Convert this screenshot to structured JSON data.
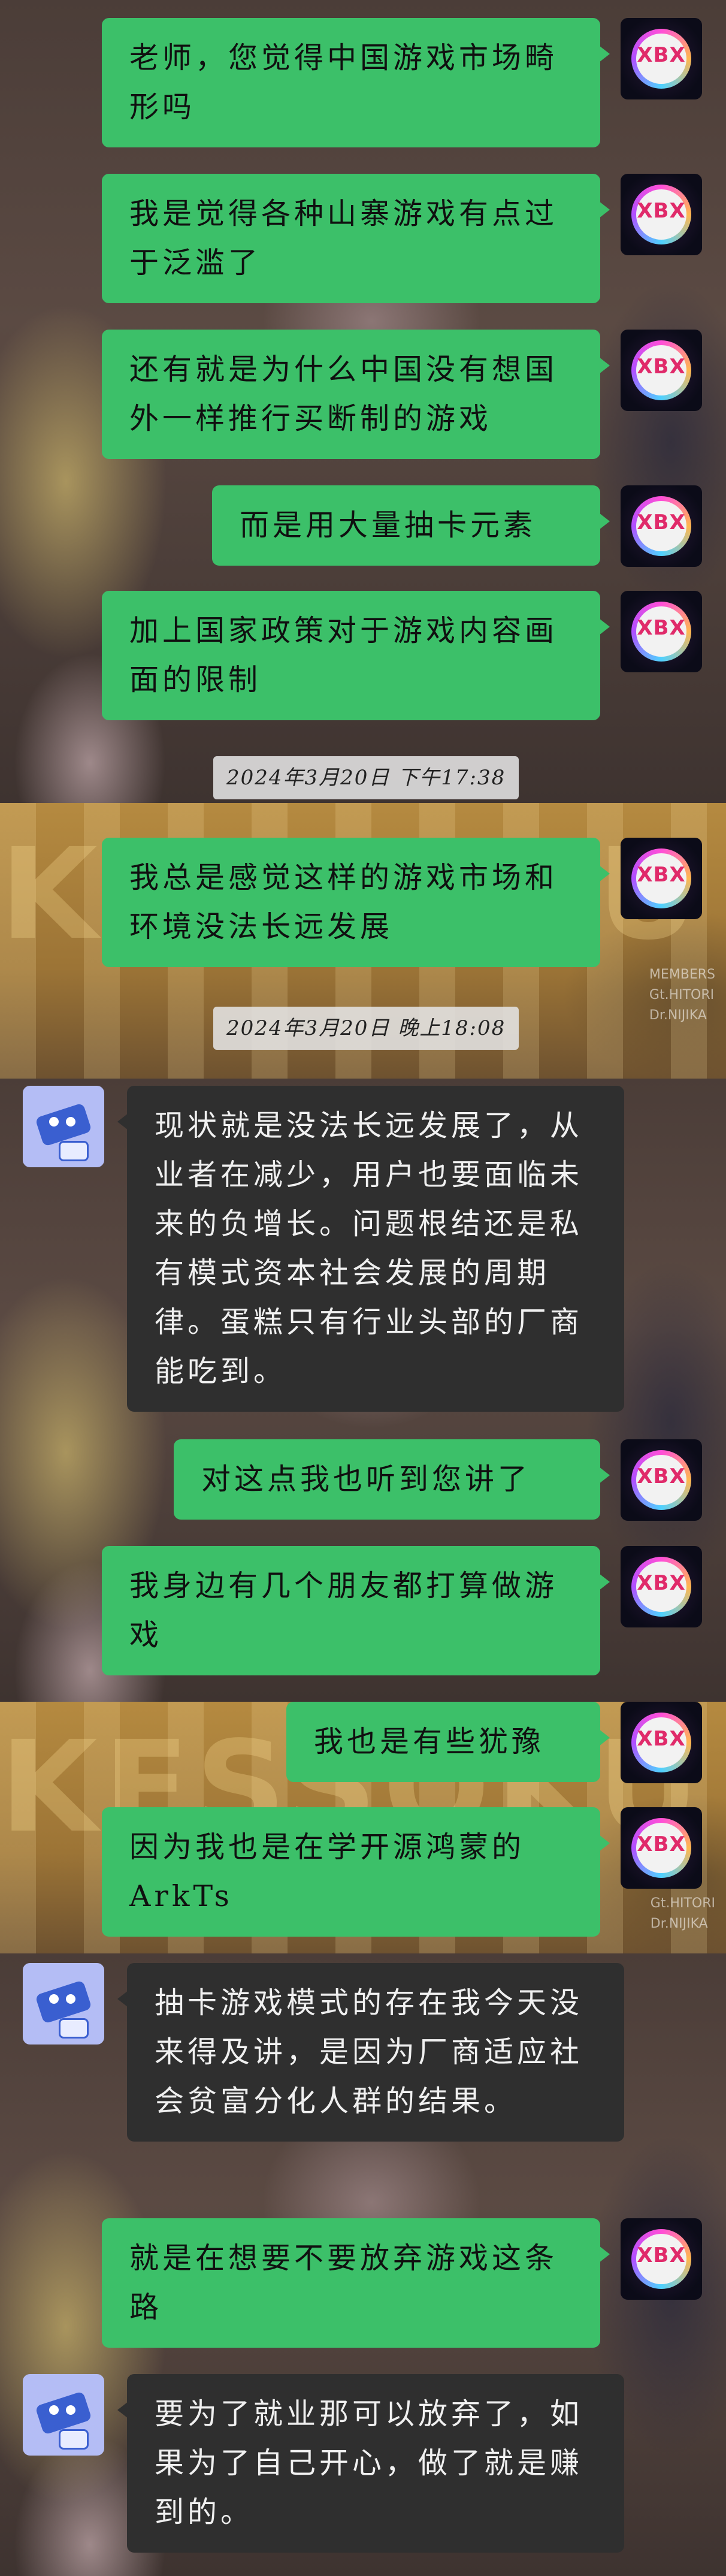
{
  "background": {
    "band_text": "KESSOKU BAND",
    "credits": [
      "MEMBERS",
      "Gt.HITORI",
      "Dr.NIJIKA"
    ]
  },
  "avatars": {
    "me_label": "XBX"
  },
  "messages": [
    {
      "side": "right",
      "text": "老师，您觉得中国游戏市场畸形吗"
    },
    {
      "side": "right",
      "text": "我是觉得各种山寨游戏有点过于泛滥了"
    },
    {
      "side": "right",
      "text": "还有就是为什么中国没有想国外一样推行买断制的游戏"
    },
    {
      "side": "right",
      "text": "而是用大量抽卡元素"
    },
    {
      "side": "right",
      "text": "加上国家政策对于游戏内容画面的限制"
    },
    {
      "type": "time",
      "text": "2024年3月20日  下午17:38"
    },
    {
      "side": "right",
      "text": "我总是感觉这样的游戏市场和环境没法长远发展"
    },
    {
      "type": "time",
      "text": "2024年3月20日  晚上18:08"
    },
    {
      "side": "left",
      "text": "现状就是没法长远发展了，从业者在减少，用户也要面临未来的负增长。问题根结还是私有模式资本社会发展的周期律。蛋糕只有行业头部的厂商能吃到。"
    },
    {
      "side": "right",
      "text": "对这点我也听到您讲了"
    },
    {
      "side": "right",
      "text": "我身边有几个朋友都打算做游戏"
    },
    {
      "side": "right",
      "text": "我也是有些犹豫"
    },
    {
      "side": "right",
      "text": "因为我也是在学开源鸿蒙的ArkTs"
    },
    {
      "side": "left",
      "text": "抽卡游戏模式的存在我今天没来得及讲，是因为厂商适应社会贫富分化人群的结果。"
    },
    {
      "side": "right",
      "text": "就是在想要不要放弃游戏这条路"
    },
    {
      "side": "left",
      "text": "要为了就业那可以放弃了，如果为了自己开心，做了就是赚到的。"
    }
  ]
}
